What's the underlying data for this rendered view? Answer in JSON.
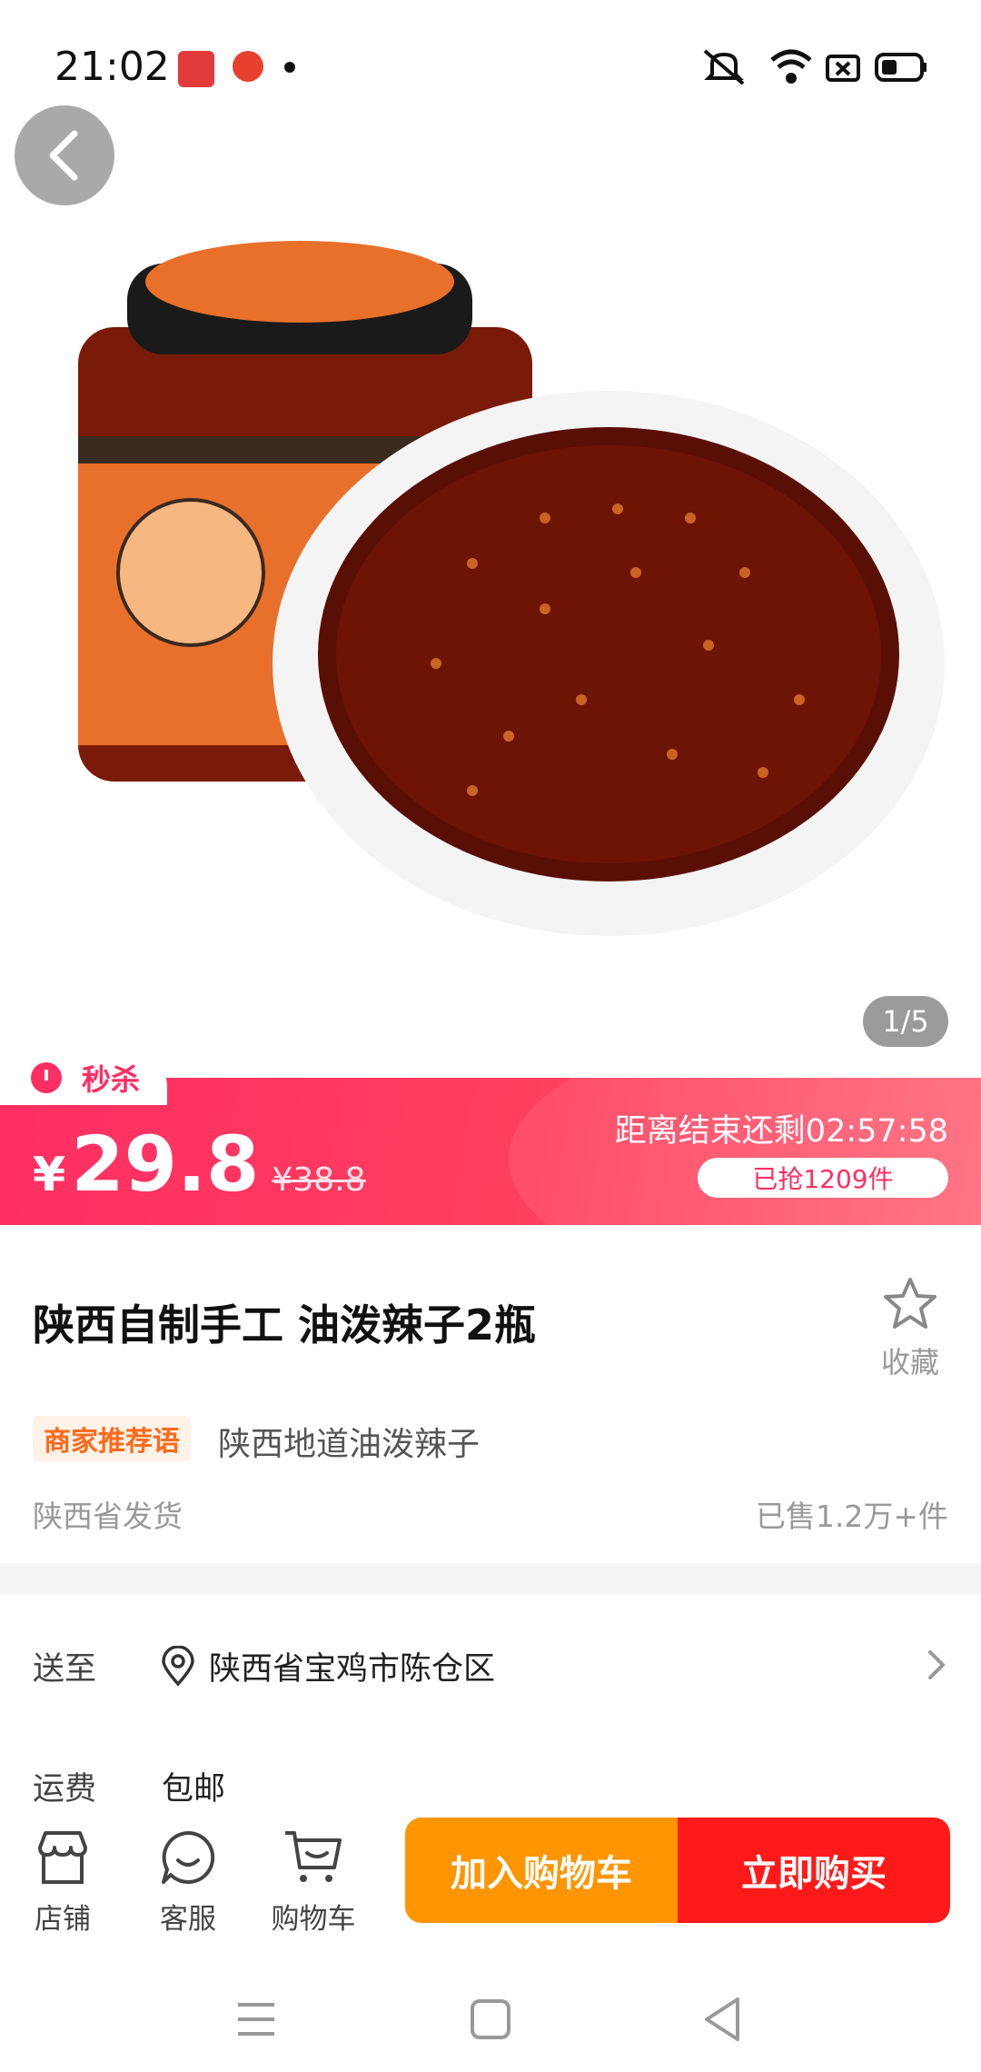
{
  "status_bar": {
    "time": "21:02"
  },
  "gallery": {
    "counter": "1/5"
  },
  "flash_sale": {
    "tag": "秒杀",
    "currency": "¥",
    "price": "29.8",
    "original_price": "¥38.8",
    "countdown": "距离结束还剩02:57:58",
    "sold_progress": "已抢1209件",
    "accent_color": "#ff2e63"
  },
  "product": {
    "title": "陕西自制手工 油泼辣子2瓶",
    "favorite_label": "收藏",
    "recommend_tag": "商家推荐语",
    "recommend_text": "陕西地道油泼辣子",
    "ship_from": "陕西省发货",
    "sold_count": "已售1.2万+件"
  },
  "delivery": {
    "to_label": "送至",
    "address": "陕西省宝鸡市陈仓区",
    "fee_label": "运费",
    "fee_value": "包邮"
  },
  "bottom_bar": {
    "store_label": "店铺",
    "service_label": "客服",
    "cart_label": "购物车",
    "add_to_cart": "加入购物车",
    "buy_now": "立即购买",
    "cart_color": "#ff9500",
    "buy_color": "#ff1a1a"
  }
}
